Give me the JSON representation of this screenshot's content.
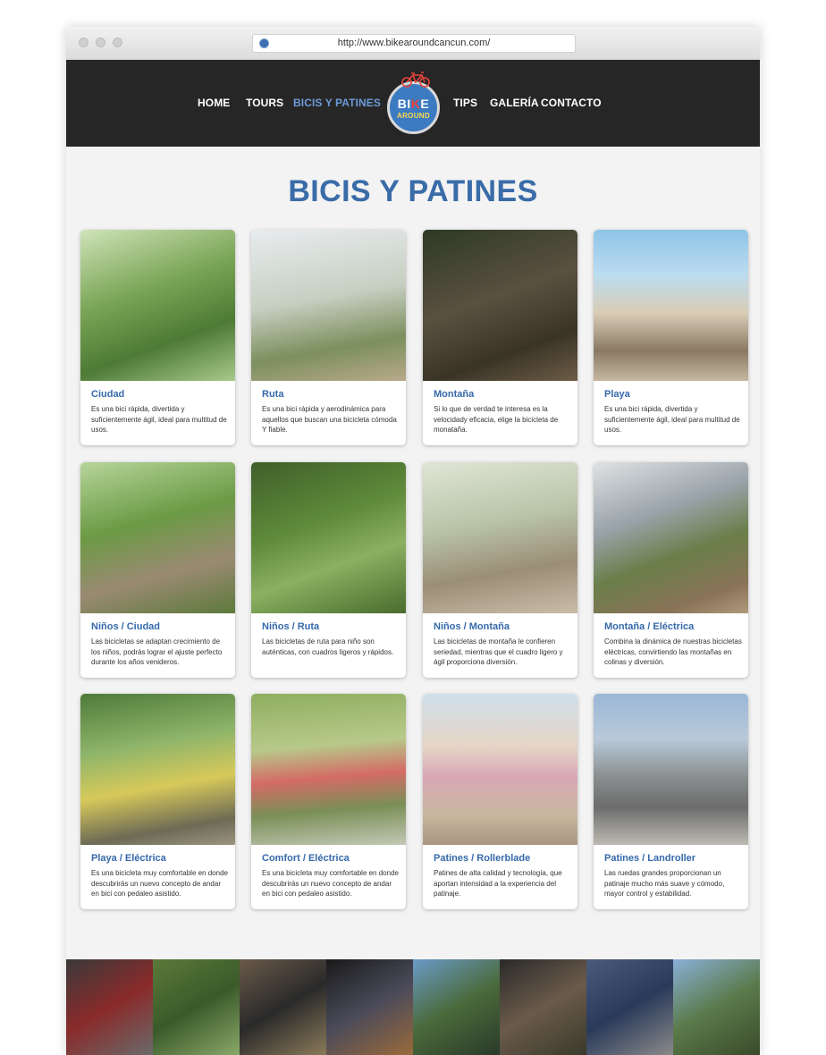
{
  "browser": {
    "url": "http://www.bikearoundcancun.com/"
  },
  "nav": {
    "items": [
      {
        "label": "HOME"
      },
      {
        "label": "TOURS"
      },
      {
        "label": "BICIS Y PATINES"
      },
      {
        "label": "TIPS"
      },
      {
        "label": "GALERÍA"
      },
      {
        "label": "CONTACTO"
      }
    ],
    "logo": {
      "line1_a": "BI",
      "line1_b": "K",
      "line1_c": "E",
      "line2": "AROUND"
    }
  },
  "page": {
    "title": "BICIS Y PATINES"
  },
  "cards": [
    {
      "name": "Ciudad",
      "desc": "Es una bici rápida, divertida y suficientemente ágil, ideal para multitud de usos."
    },
    {
      "name": "Ruta",
      "desc": "Es una bici rápida y aerodinámica para aquellos que buscan una bicicleta cómoda Y fiable."
    },
    {
      "name": "Montaña",
      "desc": "Si lo que de verdad te interesa es la velocidady eficacia, elige la bicicleta de monataña."
    },
    {
      "name": "Playa",
      "desc": "Es una bici rápida, divertida y suficientemente ágil, ideal para multitud de usos."
    },
    {
      "name": "Niños / Ciudad",
      "desc": "Las bicicletas se adaptan crecimiento de los niños, podrás lograr el ajuste perfecto durante los años venideros."
    },
    {
      "name": "Niños / Ruta",
      "desc": "Las bicicletas de ruta para niño son auténticas, con cuadros ligeros y rápidos."
    },
    {
      "name": "Niños / Montaña",
      "desc": "Las bicicletas de montaña le confieren seriedad, mientras que el cuadro ligero y ágil proporciona diversión."
    },
    {
      "name": "Montaña / Eléctrica",
      "desc": "Combina la dinámica de nuestras bicicletas eléctricas, convirtiendo las montañas en colinas y diversión."
    },
    {
      "name": "Playa / Eléctrica",
      "desc": "Es una bicicleta muy comfortable en donde descubrirás un nuevo concepto de andar en bici con pedaleo asistido."
    },
    {
      "name": "Comfort / Eléctrica",
      "desc": "Es una bicicleta muy comfortable en donde descubrirás un nuevo concepto de andar en bici con pedaleo asistido."
    },
    {
      "name": "Patines / Rollerblade",
      "desc": "Patines de alta calidad y tecnología, que aportan intensidad a la experiencia del patinaje."
    },
    {
      "name": "Patines / Landroller",
      "desc": "Las ruedas grandes proporcionan un patinaje mucho más suave y cómodo, mayor control y estabilidad."
    }
  ],
  "colors": {
    "nav_bg": "#262626",
    "accent": "#3a6ca8",
    "active_nav": "#6c9ad8",
    "page_bg": "#f3f3f3"
  }
}
